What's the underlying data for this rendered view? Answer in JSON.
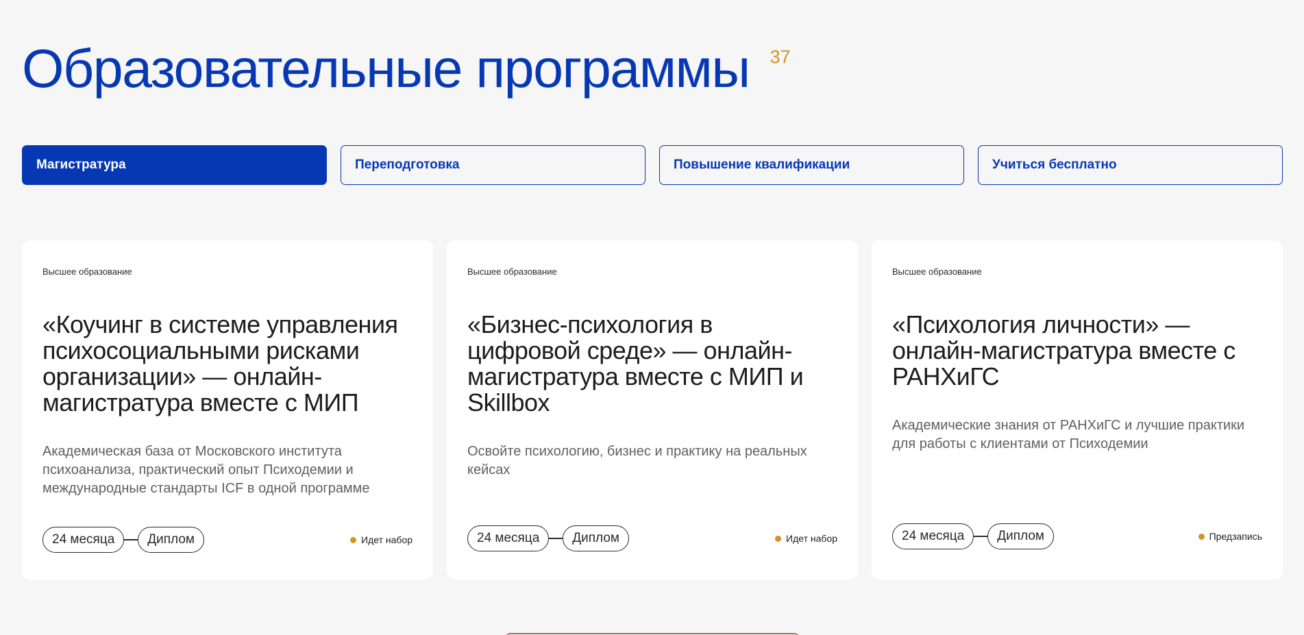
{
  "header": {
    "title": "Образовательные программы",
    "count": "37"
  },
  "tabs": [
    {
      "label": "Магистратура",
      "active": true
    },
    {
      "label": "Переподготовка",
      "active": false
    },
    {
      "label": "Повышение квалификации",
      "active": false
    },
    {
      "label": "Учиться бесплатно",
      "active": false
    }
  ],
  "cards": [
    {
      "category": "Высшее образование",
      "title": "«Коучинг в системе управления психосоциальными рисками организации» — онлайн-магистратура вместе с МИП",
      "description": "Академическая база от Московского института психоанализа, практический опыт Психодемии и международные стандарты ICF в одной программе",
      "duration": "24 месяца",
      "document": "Диплом",
      "status": "Идет набор"
    },
    {
      "category": "Высшее образование",
      "title": "«Бизнес-психология в цифровой среде» — онлайн-магистратура вместе с МИП и Skillbox",
      "description": "Освойте психологию, бизнес и практику на реальных кейсах",
      "duration": "24 месяца",
      "document": "Диплом",
      "status": "Идет набор"
    },
    {
      "category": "Высшее образование",
      "title": "«Психология личности» — онлайн-магистратура вместе с РАНХиГС",
      "description": "Академические знания от РАНХиГС и лучшие практики для работы с клиентами от Психодемии",
      "duration": "24 месяца",
      "document": "Диплом",
      "status": "Предзапись"
    }
  ],
  "colors": {
    "brand": "#0638b4",
    "accent": "#d79124",
    "background": "#f6f6f6"
  }
}
